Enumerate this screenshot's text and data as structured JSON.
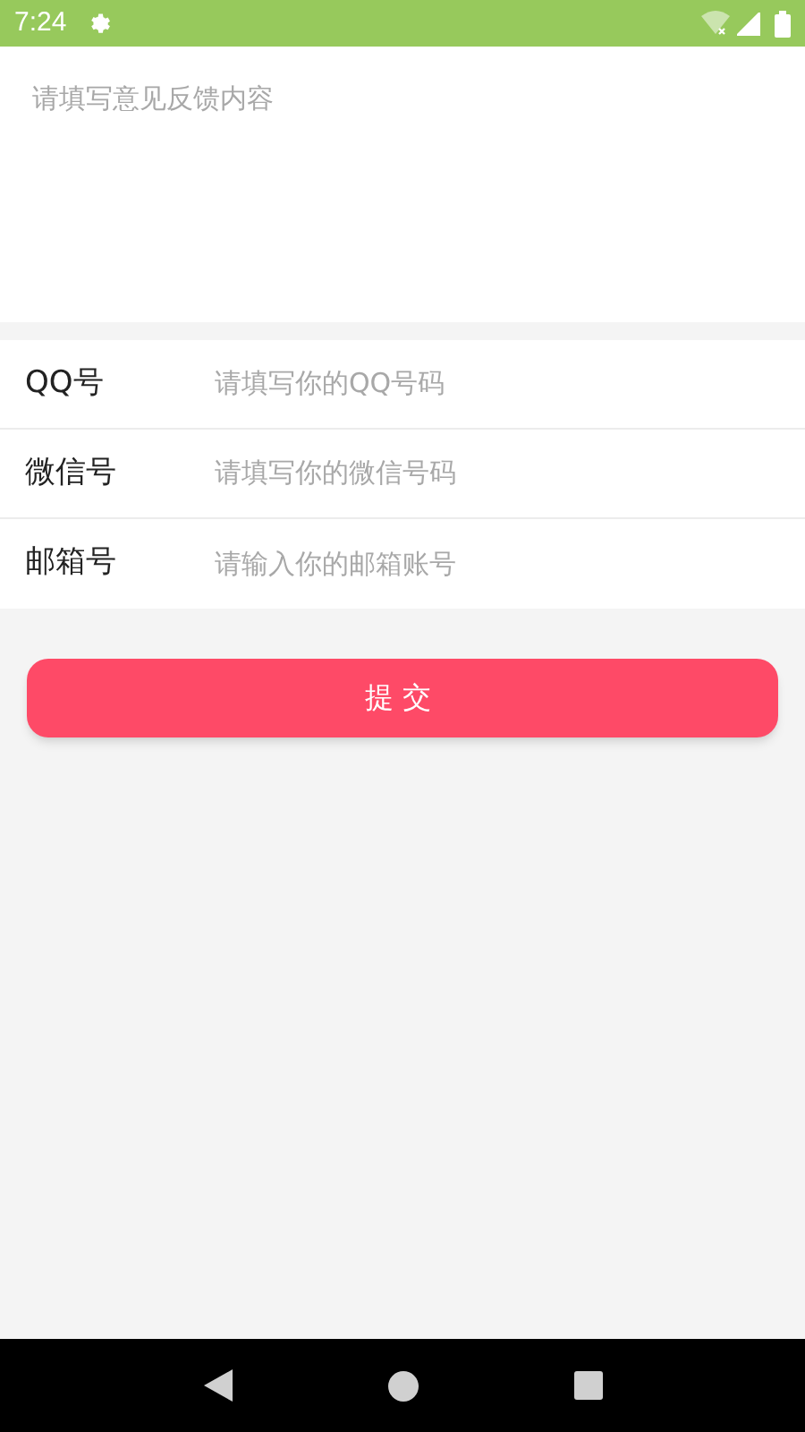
{
  "status_bar": {
    "time": "7:24"
  },
  "feedback": {
    "placeholder": "请填写意见反馈内容"
  },
  "fields": [
    {
      "label": "QQ号",
      "placeholder": "请填写你的QQ号码"
    },
    {
      "label": "微信号",
      "placeholder": "请填写你的微信号码"
    },
    {
      "label": "邮箱号",
      "placeholder": "请输入你的邮箱账号"
    }
  ],
  "submit_button": "提交"
}
